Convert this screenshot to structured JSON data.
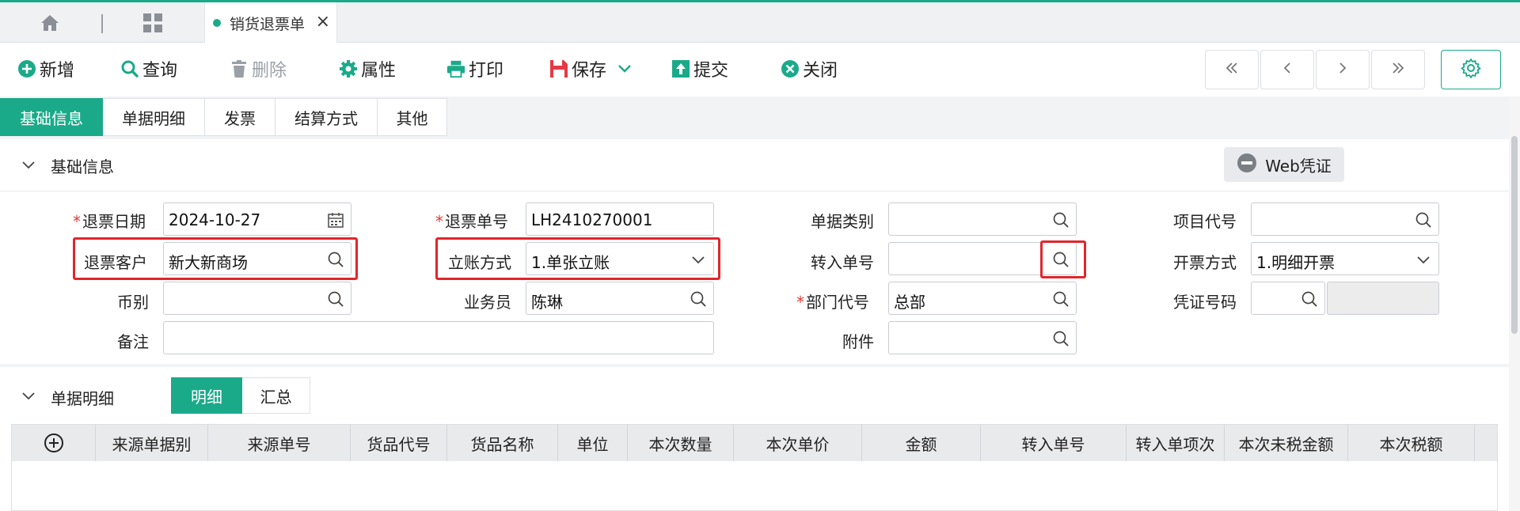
{
  "top_tabs": {
    "home_icon": "home-icon",
    "apps_icon": "grid-icon",
    "active_doc": {
      "label": "销货退票单",
      "close": "×"
    }
  },
  "toolbar": {
    "new": "新增",
    "query": "查询",
    "delete": "删除",
    "properties": "属性",
    "print": "打印",
    "save": "保存",
    "submit": "提交",
    "close": "关闭",
    "nav": [
      "«",
      "‹",
      "›",
      "»"
    ]
  },
  "section_tabs": [
    "基础信息",
    "单据明细",
    "发票",
    "结算方式",
    "其他"
  ],
  "basic_info": {
    "title": "基础信息",
    "web_voucher": "Web凭证",
    "fields": {
      "return_date": {
        "label": "退票日期",
        "value": "2024-10-27",
        "required": true
      },
      "return_no": {
        "label": "退票单号",
        "value": "LH2410270001",
        "required": true
      },
      "doc_category": {
        "label": "单据类别",
        "value": ""
      },
      "project_code": {
        "label": "项目代号",
        "value": ""
      },
      "customer": {
        "label": "退票客户",
        "value": "新大新商场"
      },
      "account_method": {
        "label": "立账方式",
        "value": "1.单张立账"
      },
      "transfer_no": {
        "label": "转入单号",
        "value": ""
      },
      "invoice_method": {
        "label": "开票方式",
        "value": "1.明细开票"
      },
      "currency": {
        "label": "币别",
        "value": ""
      },
      "salesperson": {
        "label": "业务员",
        "value": "陈琳"
      },
      "dept_code": {
        "label": "部门代号",
        "value": "总部",
        "required": true
      },
      "voucher_no": {
        "label": "凭证号码",
        "value": ""
      },
      "remark": {
        "label": "备注",
        "value": ""
      },
      "attachment": {
        "label": "附件",
        "value": ""
      }
    }
  },
  "detail": {
    "title": "单据明细",
    "segments": [
      "明细",
      "汇总"
    ],
    "columns": [
      "来源单据别",
      "来源单号",
      "货品代号",
      "货品名称",
      "单位",
      "本次数量",
      "本次单价",
      "金额",
      "转入单号",
      "转入单项次",
      "本次未税金额",
      "本次税额"
    ]
  },
  "colors": {
    "accent": "#1aaa8a",
    "highlight": "#e0262b",
    "required": "#e53935"
  }
}
